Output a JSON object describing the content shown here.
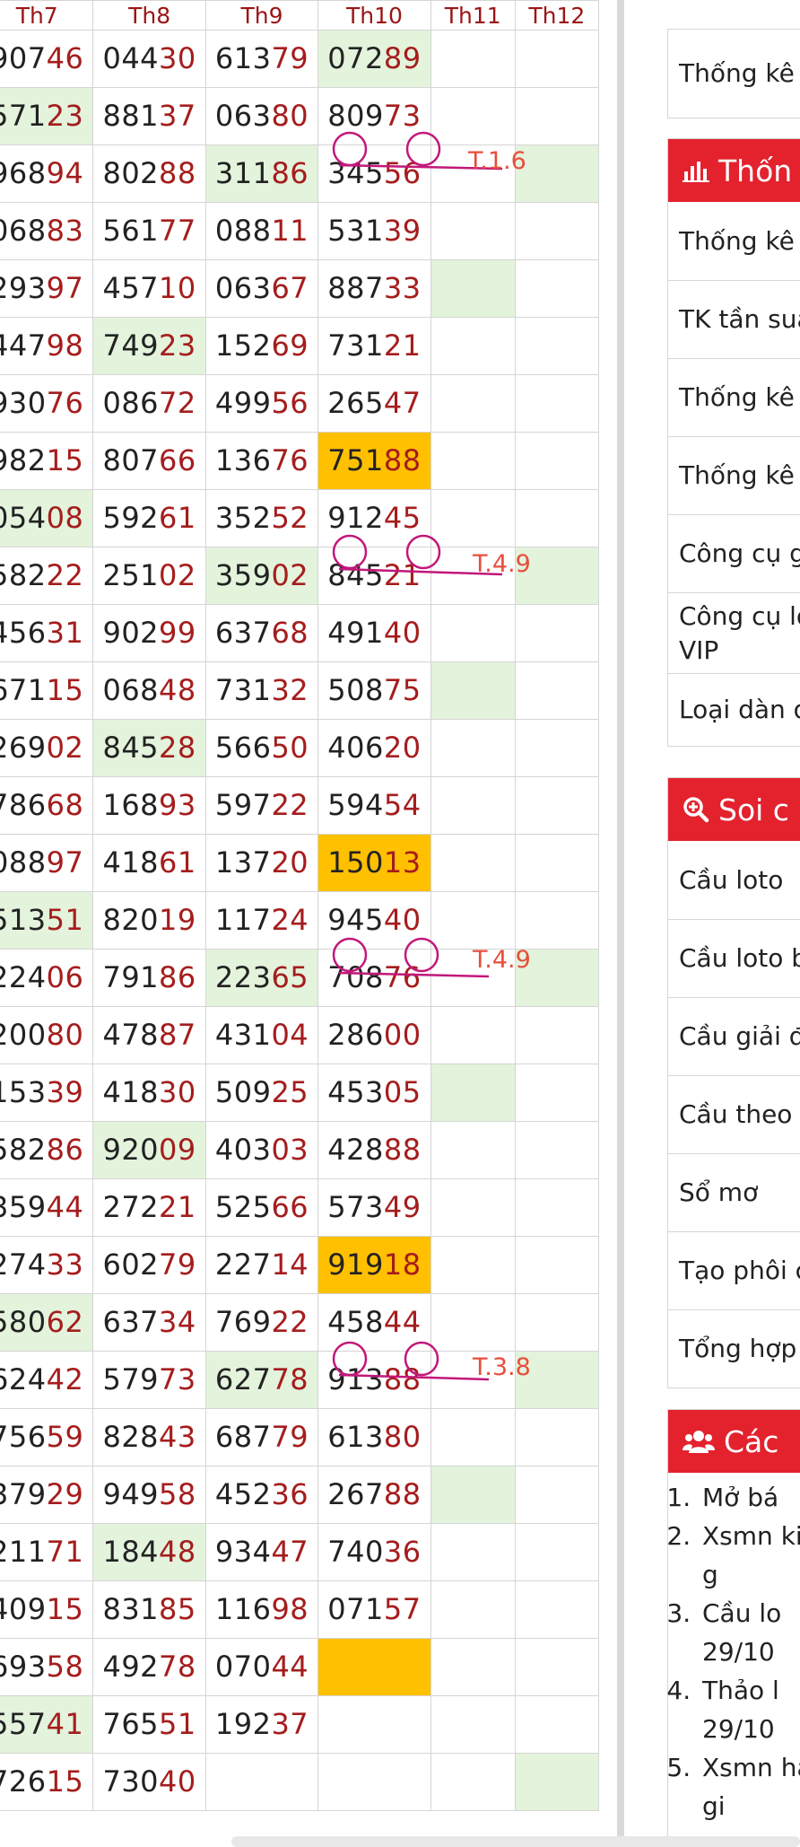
{
  "table": {
    "headers": [
      "Th7",
      "Th8",
      "Th9",
      "Th10",
      "Th11",
      "Th12"
    ],
    "rows": [
      {
        "cells": [
          "90746",
          "04430",
          "61379",
          "07289",
          "",
          ""
        ],
        "highlight": [
          "",
          "",
          "",
          "green",
          "",
          ""
        ]
      },
      {
        "cells": [
          "57123",
          "88137",
          "06380",
          "80973",
          "",
          ""
        ],
        "highlight": [
          "green",
          "",
          "",
          "",
          "",
          ""
        ]
      },
      {
        "cells": [
          "96894",
          "80288",
          "31186",
          "34556",
          "",
          ""
        ],
        "highlight": [
          "",
          "",
          "green",
          "",
          "",
          "green"
        ]
      },
      {
        "cells": [
          "06883",
          "56177",
          "08811",
          "53139",
          "",
          ""
        ],
        "highlight": [
          "",
          "",
          "",
          "",
          "",
          ""
        ]
      },
      {
        "cells": [
          "29397",
          "45710",
          "06367",
          "88733",
          "",
          ""
        ],
        "highlight": [
          "",
          "",
          "",
          "",
          "green",
          ""
        ]
      },
      {
        "cells": [
          "44798",
          "74923",
          "15269",
          "73121",
          "",
          ""
        ],
        "highlight": [
          "",
          "green",
          "",
          "",
          "",
          ""
        ]
      },
      {
        "cells": [
          "93076",
          "08672",
          "49956",
          "26547",
          "",
          ""
        ],
        "highlight": [
          "",
          "",
          "",
          "",
          "",
          ""
        ]
      },
      {
        "cells": [
          "98215",
          "80766",
          "13676",
          "75188",
          "",
          ""
        ],
        "highlight": [
          "",
          "",
          "",
          "orange",
          "",
          ""
        ]
      },
      {
        "cells": [
          "05408",
          "59261",
          "35252",
          "91245",
          "",
          ""
        ],
        "highlight": [
          "green",
          "",
          "",
          "",
          "",
          ""
        ]
      },
      {
        "cells": [
          "58222",
          "25102",
          "35902",
          "84521",
          "",
          ""
        ],
        "highlight": [
          "",
          "",
          "green",
          "",
          "",
          "green"
        ]
      },
      {
        "cells": [
          "45631",
          "90299",
          "63768",
          "49140",
          "",
          ""
        ],
        "highlight": [
          "",
          "",
          "",
          "",
          "",
          ""
        ]
      },
      {
        "cells": [
          "67115",
          "06848",
          "73132",
          "50875",
          "",
          ""
        ],
        "highlight": [
          "",
          "",
          "",
          "",
          "green",
          ""
        ]
      },
      {
        "cells": [
          "26902",
          "84528",
          "56650",
          "40620",
          "",
          ""
        ],
        "highlight": [
          "",
          "green",
          "",
          "",
          "",
          ""
        ]
      },
      {
        "cells": [
          "78668",
          "16893",
          "59722",
          "59454",
          "",
          ""
        ],
        "highlight": [
          "",
          "",
          "",
          "",
          "",
          ""
        ]
      },
      {
        "cells": [
          "08897",
          "41861",
          "13720",
          "15013",
          "",
          ""
        ],
        "highlight": [
          "",
          "",
          "",
          "orange",
          "",
          ""
        ]
      },
      {
        "cells": [
          "51351",
          "82019",
          "11724",
          "94540",
          "",
          ""
        ],
        "highlight": [
          "green",
          "",
          "",
          "",
          "",
          ""
        ]
      },
      {
        "cells": [
          "22406",
          "79186",
          "22365",
          "70876",
          "",
          ""
        ],
        "highlight": [
          "",
          "",
          "green",
          "",
          "",
          "green"
        ]
      },
      {
        "cells": [
          "20080",
          "47887",
          "43104",
          "28600",
          "",
          ""
        ],
        "highlight": [
          "",
          "",
          "",
          "",
          "",
          ""
        ]
      },
      {
        "cells": [
          "15339",
          "41830",
          "50925",
          "45305",
          "",
          ""
        ],
        "highlight": [
          "",
          "",
          "",
          "",
          "green",
          ""
        ]
      },
      {
        "cells": [
          "58286",
          "92009",
          "40303",
          "42888",
          "",
          ""
        ],
        "highlight": [
          "",
          "green",
          "",
          "",
          "",
          ""
        ]
      },
      {
        "cells": [
          "35944",
          "27221",
          "52566",
          "57349",
          "",
          ""
        ],
        "highlight": [
          "",
          "",
          "",
          "",
          "",
          ""
        ]
      },
      {
        "cells": [
          "27433",
          "60279",
          "22714",
          "91918",
          "",
          ""
        ],
        "highlight": [
          "",
          "",
          "",
          "orange",
          "",
          ""
        ]
      },
      {
        "cells": [
          "58062",
          "63734",
          "76922",
          "45844",
          "",
          ""
        ],
        "highlight": [
          "green",
          "",
          "",
          "",
          "",
          ""
        ]
      },
      {
        "cells": [
          "62442",
          "57973",
          "62778",
          "91388",
          "",
          ""
        ],
        "highlight": [
          "",
          "",
          "green",
          "",
          "",
          "green"
        ]
      },
      {
        "cells": [
          "75659",
          "82843",
          "68779",
          "61380",
          "",
          ""
        ],
        "highlight": [
          "",
          "",
          "",
          "",
          "",
          ""
        ]
      },
      {
        "cells": [
          "37929",
          "94958",
          "45236",
          "26788",
          "",
          ""
        ],
        "highlight": [
          "",
          "",
          "",
          "",
          "green",
          ""
        ]
      },
      {
        "cells": [
          "21171",
          "18448",
          "93447",
          "74036",
          "",
          ""
        ],
        "highlight": [
          "",
          "green",
          "",
          "",
          "",
          ""
        ]
      },
      {
        "cells": [
          "40915",
          "83185",
          "11698",
          "07157",
          "",
          ""
        ],
        "highlight": [
          "",
          "",
          "",
          "",
          "",
          ""
        ]
      },
      {
        "cells": [
          "69358",
          "49278",
          "07044",
          "",
          "",
          ""
        ],
        "highlight": [
          "",
          "",
          "",
          "orange",
          "",
          ""
        ]
      },
      {
        "cells": [
          "55741",
          "76551",
          "19237",
          "",
          "",
          ""
        ],
        "highlight": [
          "green",
          "",
          "",
          "",
          "",
          ""
        ]
      },
      {
        "cells": [
          "72615",
          "73040",
          "",
          "",
          "",
          ""
        ],
        "highlight": [
          "",
          "",
          "",
          "",
          "",
          "green"
        ]
      }
    ]
  },
  "annotations": [
    "T.1.6",
    "T.4.9",
    "T.4.9",
    "T.3.8"
  ],
  "sidebar": {
    "box1_items": [
      "Thống kê g"
    ],
    "box2_title": "Thốn",
    "box2_items": [
      "Thống kê n",
      "TK tần suấ",
      "Thống kê t",
      "Thống kê t",
      "Công cụ g",
      "Công cụ lọ VIP",
      "Loại dàn đ"
    ],
    "box3_title": "Soi c",
    "box3_items": [
      "Cầu loto",
      "Cầu loto b",
      "Cầu giải đ",
      "Cầu theo t",
      "Sổ mơ",
      "Tạo phôi c",
      "Tổng hợp"
    ],
    "box4_title": "Các",
    "box4_articles": [
      "Mở bá",
      "Xsmn kiên g",
      "Cầu lo 29/10",
      "Thảo l 29/10",
      "Xsmn hậu gi"
    ]
  },
  "colors": {
    "accent_red": "#e3222e",
    "cell_green": "#e3f3dc",
    "cell_orange": "#ffc000",
    "annotation_pink": "#c2187a",
    "annotation_text": "#e84e3c"
  }
}
